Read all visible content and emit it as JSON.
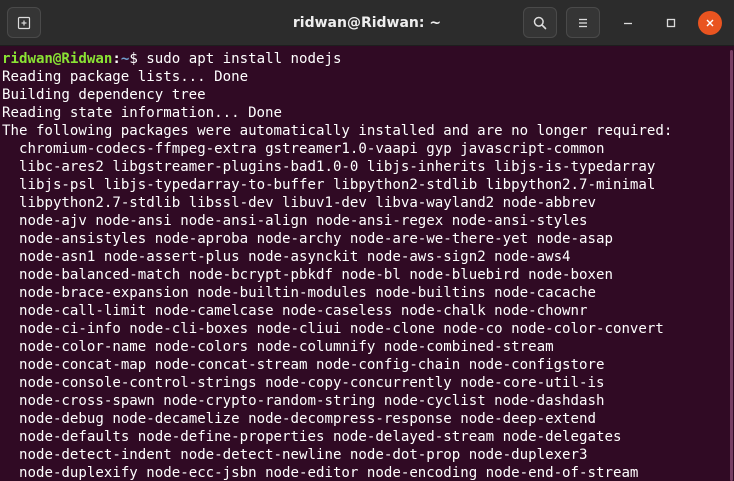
{
  "window": {
    "title": "ridwan@Ridwan: ~"
  },
  "prompt": {
    "user_host": "ridwan@Ridwan",
    "separator": ":",
    "path": "~",
    "symbol": "$",
    "command": " sudo apt install nodejs"
  },
  "output": [
    "Reading package lists... Done",
    "Building dependency tree",
    "Reading state information... Done",
    "The following packages were automatically installed and are no longer required:"
  ],
  "packages": [
    "chromium-codecs-ffmpeg-extra gstreamer1.0-vaapi gyp javascript-common",
    "libc-ares2 libgstreamer-plugins-bad1.0-0 libjs-inherits libjs-is-typedarray",
    "libjs-psl libjs-typedarray-to-buffer libpython2-stdlib libpython2.7-minimal",
    "libpython2.7-stdlib libssl-dev libuv1-dev libva-wayland2 node-abbrev",
    "node-ajv node-ansi node-ansi-align node-ansi-regex node-ansi-styles",
    "node-ansistyles node-aproba node-archy node-are-we-there-yet node-asap",
    "node-asn1 node-assert-plus node-asynckit node-aws-sign2 node-aws4",
    "node-balanced-match node-bcrypt-pbkdf node-bl node-bluebird node-boxen",
    "node-brace-expansion node-builtin-modules node-builtins node-cacache",
    "node-call-limit node-camelcase node-caseless node-chalk node-chownr",
    "node-ci-info node-cli-boxes node-cliui node-clone node-co node-color-convert",
    "node-color-name node-colors node-columnify node-combined-stream",
    "node-concat-map node-concat-stream node-config-chain node-configstore",
    "node-console-control-strings node-copy-concurrently node-core-util-is",
    "node-cross-spawn node-crypto-random-string node-cyclist node-dashdash",
    "node-debug node-decamelize node-decompress-response node-deep-extend",
    "node-defaults node-define-properties node-delayed-stream node-delegates",
    "node-detect-indent node-detect-newline node-dot-prop node-duplexer3",
    "node-duplexify node-ecc-jsbn node-editor node-encoding node-end-of-stream"
  ],
  "colors": {
    "background": "#300a24",
    "titlebar": "#2c2c2c",
    "prompt_user": "#8ae234",
    "prompt_path": "#729fcf",
    "close_button": "#e95420"
  },
  "icons": {
    "new_tab": "new-tab-icon",
    "search": "search-icon",
    "menu": "hamburger-menu-icon",
    "minimize": "minimize-icon",
    "maximize": "maximize-icon",
    "close": "close-icon"
  }
}
